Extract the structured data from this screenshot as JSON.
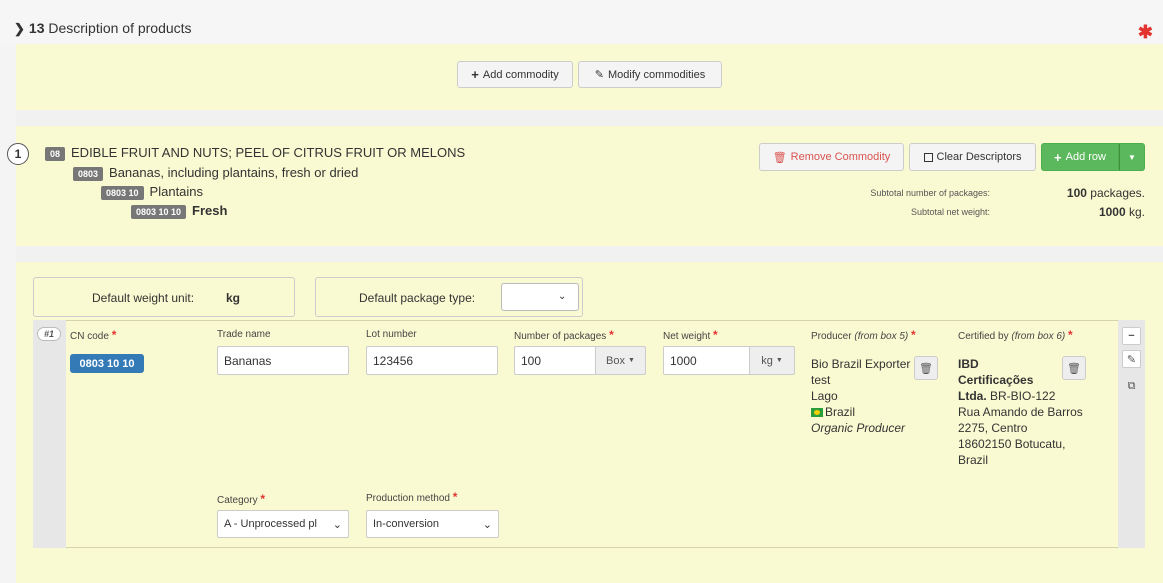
{
  "section": {
    "chevron": "❯",
    "number": "13",
    "title": "Description of products",
    "required_mark": "✱"
  },
  "toolbar": {
    "add_commodity": "Add commodity",
    "modify_commodities": "Modify commodities",
    "add_icon": "+",
    "edit_icon": "✎"
  },
  "commodity": {
    "index": "1",
    "levels": [
      {
        "code": "08",
        "text": "EDIBLE FRUIT AND NUTS; PEEL OF CITRUS FRUIT OR MELONS"
      },
      {
        "code": "0803",
        "text": "Bananas, including plantains, fresh or dried"
      },
      {
        "code": "0803 10",
        "text": "Plantains"
      },
      {
        "code": "0803 10 10",
        "text": "Fresh"
      }
    ],
    "remove_label": "Remove Commodity",
    "clear_label": "Clear Descriptors",
    "add_row_label": "Add row",
    "subtotal_packages_label": "Subtotal number of packages:",
    "subtotal_packages_value": "100",
    "subtotal_packages_unit": "packages.",
    "subtotal_weight_label": "Subtotal net weight:",
    "subtotal_weight_value": "1000",
    "subtotal_weight_unit": "kg."
  },
  "defaults": {
    "weight_label": "Default weight unit:",
    "weight_value": "kg",
    "package_label": "Default package type:"
  },
  "row": {
    "number": "#1",
    "labels": {
      "cn_code": "CN code",
      "trade_name": "Trade name",
      "lot_number": "Lot number",
      "num_packages": "Number of packages",
      "net_weight": "Net weight",
      "producer": "Producer",
      "producer_note": "(from box 5)",
      "certified": "Certified by",
      "certified_note": "(from box 6)",
      "category": "Category",
      "production_method": "Production method",
      "req": "*"
    },
    "cn_code": "0803 10 10",
    "trade_name": "Bananas",
    "lot_number": "123456",
    "num_packages": "100",
    "package_unit": "Box",
    "net_weight": "1000",
    "weight_unit": "kg",
    "producer": {
      "line1": "Bio Brazil Exporter",
      "line2": "test",
      "line3": "Lago",
      "country": "Brazil",
      "role": "Organic Producer"
    },
    "certifier": {
      "name1": "IBD",
      "name2": "Certificações",
      "name3": "Ltda.",
      "code": "BR-BIO-122",
      "addr1": "Rua Amando de Barros",
      "addr2": "2275, Centro",
      "addr3": "18602150 Botucatu,",
      "addr4": "Brazil"
    },
    "category": "A - Unprocessed pl",
    "production_method": "In-conversion"
  },
  "colors": {
    "panel": "#fafad2",
    "primary": "#337ab7",
    "success": "#5cb85c",
    "danger": "#d9534f"
  }
}
